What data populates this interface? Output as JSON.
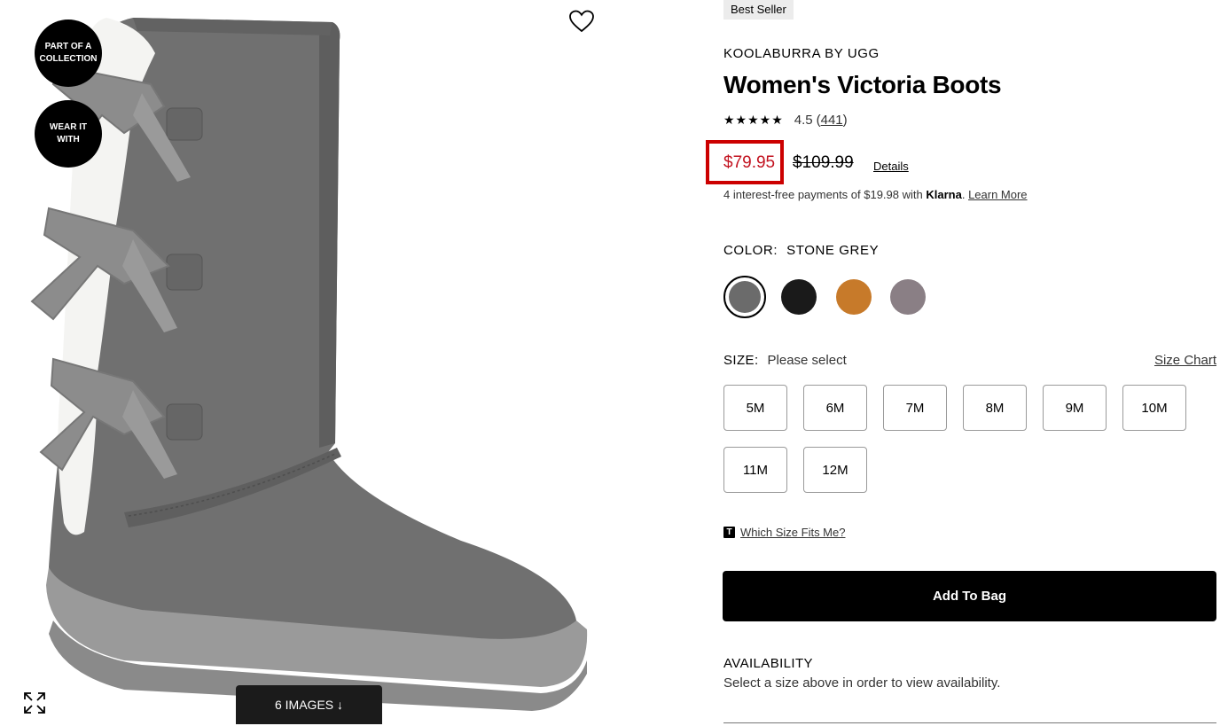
{
  "gallery": {
    "badges": [
      "PART OF A COLLECTION",
      "WEAR IT WITH"
    ],
    "images_button": "6 IMAGES ↓",
    "icons": {
      "favorite": "heart-icon",
      "expand": "expand-icon"
    }
  },
  "product": {
    "badge": "Best Seller",
    "brand": "KOOLABURRA BY UGG",
    "title": "Women's Victoria Boots",
    "rating": {
      "stars": "★★★★★",
      "value": "4.5",
      "count": "441",
      "stars_filled": 4.5
    },
    "price": {
      "sale": "$79.95",
      "original": "$109.99",
      "details_link": "Details"
    },
    "klarna": {
      "prefix": "4 interest-free payments of $19.98 with",
      "brand": "Klarna",
      "learn_more": "Learn More"
    },
    "color": {
      "label": "COLOR:",
      "selected": "STONE GREY",
      "swatches": [
        "#6b6b6b",
        "#1a1a1a",
        "#c77a2a",
        "#8a7f85"
      ]
    },
    "size": {
      "label": "SIZE:",
      "selected": "Please select",
      "chart_link": "Size Chart",
      "options": [
        "5M",
        "6M",
        "7M",
        "8M",
        "9M",
        "10M",
        "11M",
        "12M"
      ],
      "fit_icon": "T",
      "fit_link": "Which Size Fits Me?"
    },
    "add_to_bag": "Add To Bag",
    "availability": {
      "title": "AVAILABILITY",
      "text": "Select a size above in order to view availability."
    }
  },
  "colors": {
    "sale_red": "#c2121f",
    "highlight_box": "#cc0000",
    "button_black": "#000000"
  }
}
